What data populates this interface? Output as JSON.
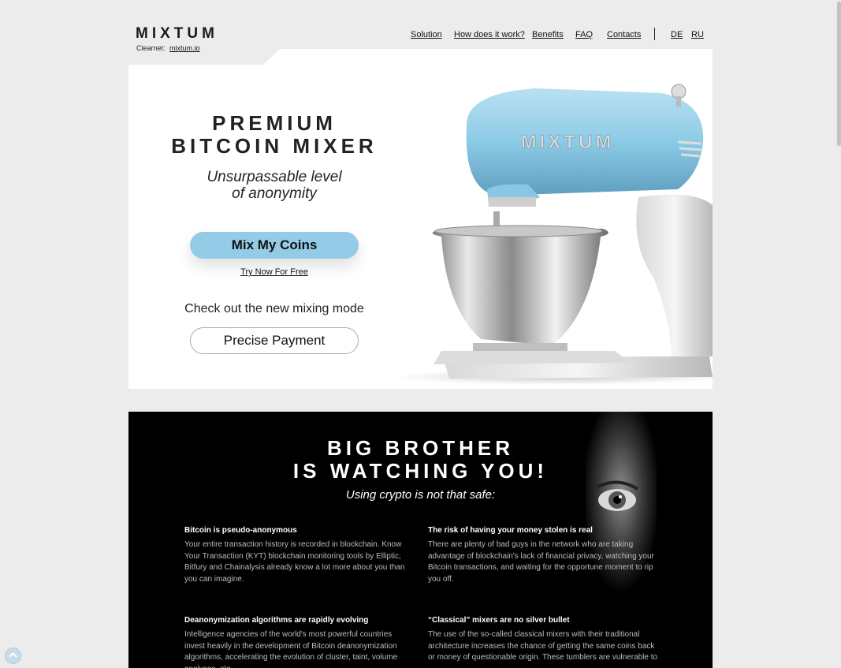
{
  "header": {
    "logo": "MIXTUM",
    "clearnet_label": "Clearnet:",
    "clearnet_link": "mixtum.io",
    "nav": [
      "Solution",
      "How does it work?",
      "Benefits",
      "FAQ",
      "Contacts"
    ],
    "languages": [
      "DE",
      "RU"
    ]
  },
  "hero": {
    "title_line1": "PREMIUM",
    "title_line2": "BITCOIN MIXER",
    "subtitle_line1": "Unsurpassable level",
    "subtitle_line2": "of anonymity",
    "cta_label": "Mix My Coins",
    "try_free": "Try Now For Free",
    "mode_text": "Check out the new mixing mode",
    "mode_button": "Precise Payment",
    "product_brand": "MIXTUM"
  },
  "big_brother": {
    "title_line1": "BIG BROTHER",
    "title_line2": "IS WATCHING YOU!",
    "subtitle": "Using crypto is not that safe:",
    "features": [
      {
        "title": "Bitcoin is pseudo-anonymous",
        "text": "Your entire transaction history is recorded in blockchain. Know Your Transaction (KYT) blockchain monitoring tools by Elliptic, Bitfury and Chainalysis already know a lot more about you than you can imagine."
      },
      {
        "title": "The risk of having your money stolen is real",
        "text": "There are plenty of bad guys in the network who are taking advantage of blockchain's lack of financial privacy, watching your Bitcoin transactions, and waiting for the opportune moment to rip you off."
      },
      {
        "title": "Deanonymization algorithms are rapidly evolving",
        "text": "Intelligence agencies of the world's most powerful countries invest heavily in the development of Bitcoin deanonymization algorithms, accelerating the evolution of cluster, taint, volume analyses, etc."
      },
      {
        "title": "“Classical” mixers are no silver bullet",
        "text": "The use of the so-called classical mixers with their traditional architecture increases the chance of getting the same coins back or money of questionable origin. These tumblers are vulnerable to"
      }
    ]
  },
  "colors": {
    "accent": "#94cbe6",
    "page_bg": "#ececec",
    "dark_bg": "#000000"
  },
  "icons": {
    "scroll_top": "chevron-up-icon"
  }
}
